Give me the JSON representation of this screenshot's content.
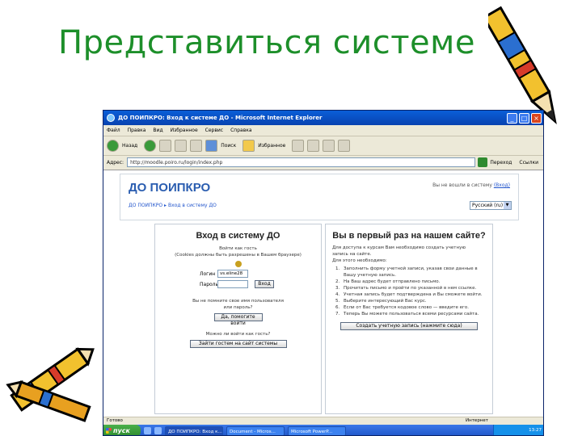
{
  "slide": {
    "title": "Представиться системе"
  },
  "browser": {
    "window_title": "ДО ПОИПКРО: Вход к системе ДО - Microsoft Internet Explorer",
    "menu": [
      "Файл",
      "Правка",
      "Вид",
      "Избранное",
      "Сервис",
      "Справка"
    ],
    "toolbar": {
      "back_label": "Назад",
      "search_label": "Поиск",
      "favorites_label": "Избранное"
    },
    "address_label": "Адрес:",
    "address_value": "http://moodle.poiro.ru/login/index.php",
    "go_label": "Переход",
    "links_label": "Ссылки"
  },
  "site": {
    "logo": "ДО ПОИПКРО",
    "login_status": "Вы не вошли в систему",
    "login_status_link": "(Вход)",
    "breadcrumb": "ДО ПОИПКРО ▸ Вход в систему ДО",
    "language": "Русский (ru)"
  },
  "login_panel": {
    "title": "Вход в систему ДО",
    "cookies_line1": "Войти как гость",
    "cookies_line2": "(Cookies должны быть разрешены в Вашем браузере)",
    "login_label": "Логин",
    "login_value": "vs.eline28",
    "password_label": "Пароль",
    "login_button": "Вход",
    "forgot_line1": "Вы не помните свое имя пользователя",
    "forgot_line2": "или пароль?",
    "send_password_button": "Да, помогите войти",
    "guest_question": "Можно ли войти как гость?",
    "guest_button": "Зайти гостем на сайт системы"
  },
  "first_time_panel": {
    "title": "Вы в первый раз на нашем сайте?",
    "intro_line1": "Для доступа к курсам Вам необходимо создать учетную",
    "intro_line2": "запись на сайте.",
    "intro_line3": "Для этого необходимо:",
    "steps": [
      {
        "n": "1.",
        "text": "Заполнить форму учетной записи, указав свои данные в Вашу учетную запись."
      },
      {
        "n": "2.",
        "text": "На Ваш адрес будет отправлено письмо."
      },
      {
        "n": "3.",
        "text": "Прочитать письмо и пройти по указанной в нем ссылке."
      },
      {
        "n": "4.",
        "text": "Учетная запись будет подтверждена и Вы сможете войти."
      },
      {
        "n": "5.",
        "text": "Выберите интересующий Вас курс."
      },
      {
        "n": "6.",
        "text": "Если от Вас требуется кодовое слово — введите его."
      },
      {
        "n": "7.",
        "text": "Теперь Вы можете пользоваться всеми ресурсами сайта."
      }
    ],
    "create_account_button": "Создать учетную запись (нажмите сюда)"
  },
  "statusbar": {
    "left": "Готово",
    "zone": "Интернет"
  },
  "taskbar": {
    "start_label": "пуск",
    "tasks": [
      "ДО ПОИПКРО: Вход к...",
      "Document - Micros...",
      "Microsoft PowerP..."
    ],
    "clock": "13:27"
  },
  "colors": {
    "slide_title": "#1d8f2a",
    "titlebar": "#0842b0",
    "link": "#2255cc",
    "logo": "#2a5db0"
  }
}
